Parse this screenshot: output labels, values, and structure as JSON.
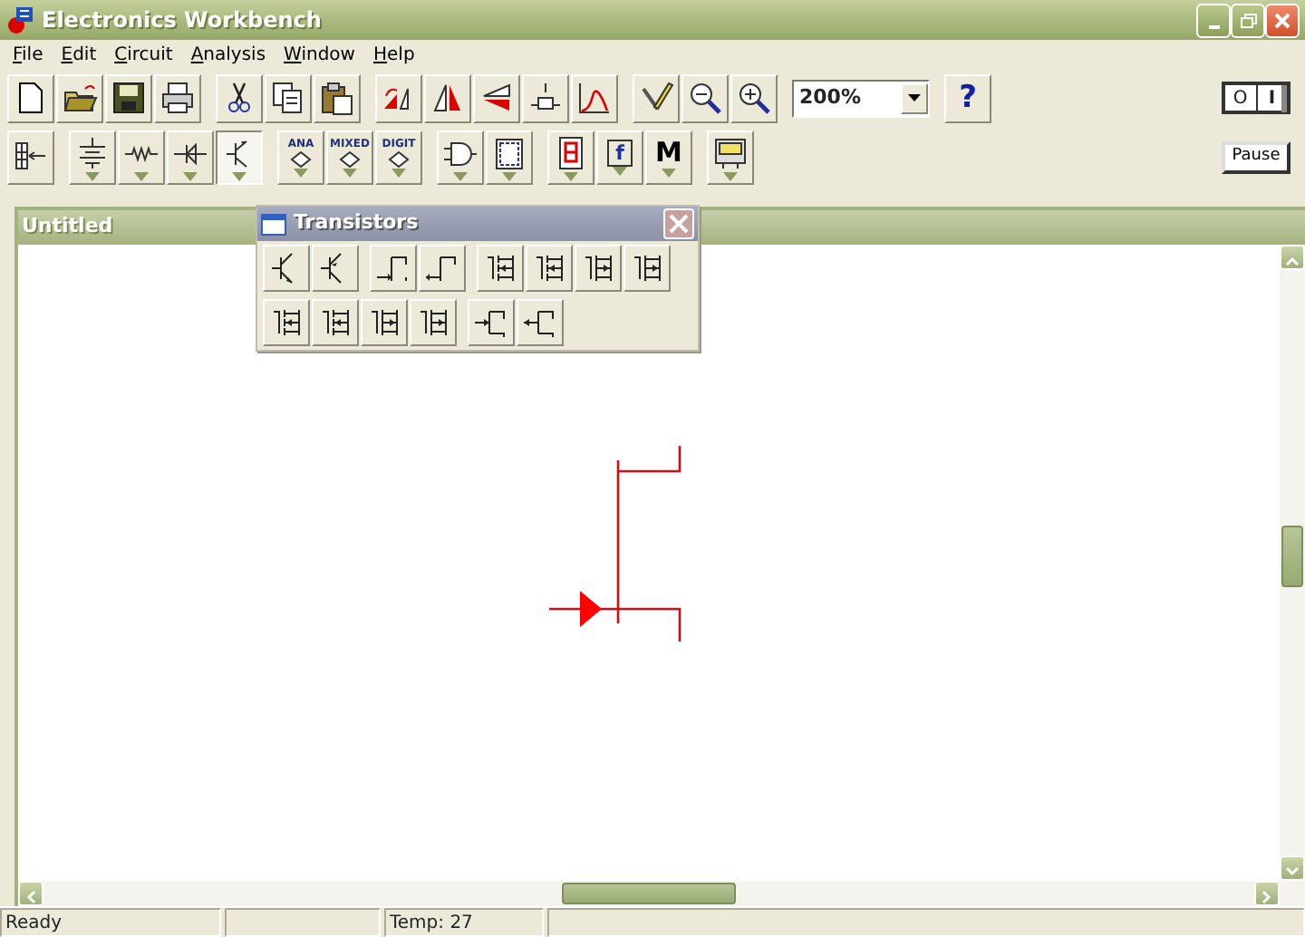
{
  "window": {
    "title": "Electronics Workbench"
  },
  "menu": [
    {
      "label": "File"
    },
    {
      "label": "Edit"
    },
    {
      "label": "Circuit"
    },
    {
      "label": "Analysis"
    },
    {
      "label": "Window"
    },
    {
      "label": "Help"
    }
  ],
  "toolbar1": {
    "groups": [
      [
        {
          "kind": "new"
        },
        {
          "kind": "open"
        },
        {
          "kind": "save"
        },
        {
          "kind": "print"
        }
      ],
      [
        {
          "kind": "cut"
        },
        {
          "kind": "copy"
        },
        {
          "kind": "paste"
        }
      ],
      [
        {
          "kind": "rotate"
        },
        {
          "kind": "flip-h"
        },
        {
          "kind": "flip-v"
        },
        {
          "kind": "subcircuit"
        },
        {
          "kind": "graph"
        }
      ],
      [
        {
          "kind": "properties"
        },
        {
          "kind": "zoom-out"
        },
        {
          "kind": "zoom-in"
        }
      ]
    ],
    "zoom_select": {
      "value": "200%"
    },
    "help_button": {
      "label": "?"
    }
  },
  "power_switch": {
    "on": false,
    "off_label": "O",
    "on_label": "I"
  },
  "toolbar2": {
    "groups": [
      [
        {
          "kind": "favorites",
          "selected": false
        }
      ],
      [
        {
          "kind": "source",
          "selected": false
        },
        {
          "kind": "resistor",
          "selected": false
        },
        {
          "kind": "diode",
          "selected": false
        },
        {
          "kind": "transistor",
          "selected": true
        }
      ],
      [
        {
          "kind": "chip",
          "label": "ANA",
          "selected": false
        },
        {
          "kind": "chip",
          "label": "MIXED",
          "selected": false
        },
        {
          "kind": "chip",
          "label": "DIGIT",
          "selected": false
        }
      ],
      [
        {
          "kind": "gate",
          "selected": false
        },
        {
          "kind": "flipflop",
          "selected": false
        }
      ],
      [
        {
          "kind": "display",
          "selected": false
        },
        {
          "kind": "boxed",
          "label": "f",
          "selected": false
        },
        {
          "kind": "letter",
          "label": "M",
          "selected": false
        }
      ],
      [
        {
          "kind": "instrument",
          "selected": false
        }
      ]
    ]
  },
  "pause_button": {
    "label": "Pause"
  },
  "document": {
    "title": "Untitled"
  },
  "parts_bin": {
    "title": "Transistors",
    "rows": [
      [
        [
          {
            "kind": "npn"
          },
          {
            "kind": "pnp"
          }
        ],
        [
          {
            "kind": "jfet-n"
          },
          {
            "kind": "jfet-p"
          }
        ],
        [
          {
            "kind": "mos"
          },
          {
            "kind": "mos"
          },
          {
            "kind": "mos2"
          },
          {
            "kind": "mos2"
          }
        ]
      ],
      [
        [
          {
            "kind": "mos"
          },
          {
            "kind": "mos"
          },
          {
            "kind": "mos2"
          },
          {
            "kind": "mos2"
          }
        ],
        [
          {
            "kind": "gaas-n"
          },
          {
            "kind": "gaas-p"
          }
        ]
      ]
    ]
  },
  "status_bar": {
    "message": "Ready",
    "temperature": "Temp: 27"
  }
}
